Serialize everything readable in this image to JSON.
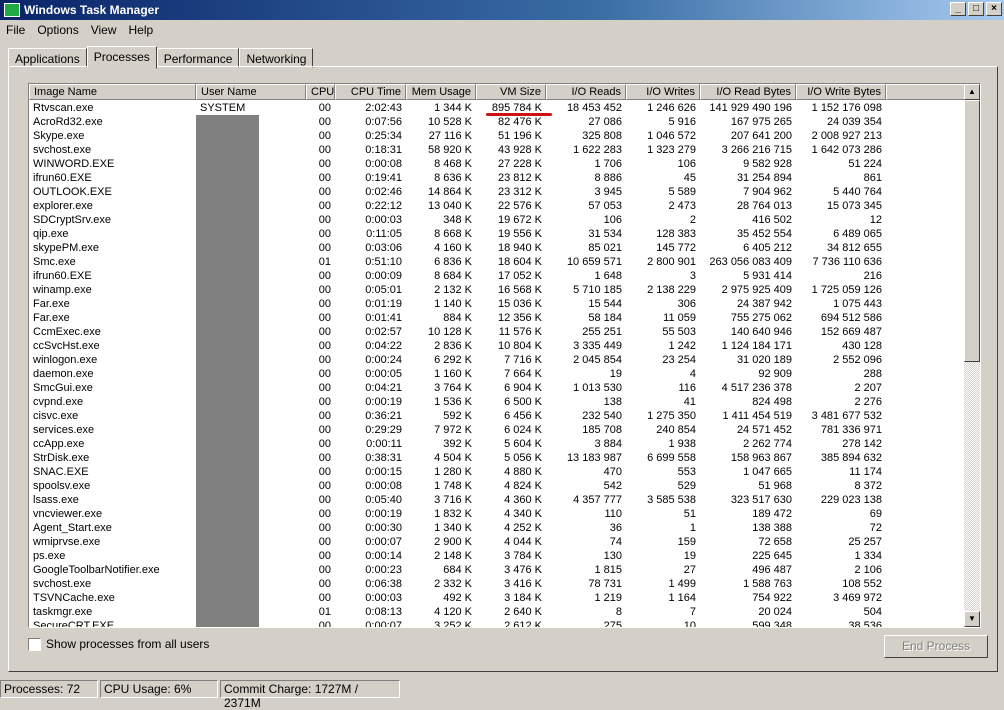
{
  "window": {
    "title": "Windows Task Manager",
    "controls": [
      "_",
      "□",
      "×"
    ]
  },
  "menu": [
    "File",
    "Options",
    "View",
    "Help"
  ],
  "tabs": [
    "Applications",
    "Processes",
    "Performance",
    "Networking"
  ],
  "active_tab": 1,
  "columns": [
    "Image Name",
    "User Name",
    "CPU",
    "CPU Time",
    "Mem Usage",
    "VM Size",
    "I/O Reads",
    "I/O Writes",
    "I/O Read Bytes",
    "I/O Write Bytes"
  ],
  "rows": [
    [
      "Rtvscan.exe",
      "SYSTEM",
      "00",
      "2:02:43",
      "1 344 K",
      "895 784 K",
      "18 453 452",
      "1 246 626",
      "141 929 490 196",
      "1 152 176 098"
    ],
    [
      "AcroRd32.exe",
      "",
      "00",
      "0:07:56",
      "10 528 K",
      "82 476 K",
      "27 086",
      "5 916",
      "167 975 265",
      "24 039 354"
    ],
    [
      "Skype.exe",
      "",
      "00",
      "0:25:34",
      "27 116 K",
      "51 196 K",
      "325 808",
      "1 046 572",
      "207 641 200",
      "2 008 927 213"
    ],
    [
      "svchost.exe",
      "",
      "00",
      "0:18:31",
      "58 920 K",
      "43 928 K",
      "1 622 283",
      "1 323 279",
      "3 266 216 715",
      "1 642 073 286"
    ],
    [
      "WINWORD.EXE",
      "",
      "00",
      "0:00:08",
      "8 468 K",
      "27 228 K",
      "1 706",
      "106",
      "9 582 928",
      "51 224"
    ],
    [
      "ifrun60.EXE",
      "",
      "00",
      "0:19:41",
      "8 636 K",
      "23 812 K",
      "8 886",
      "45",
      "31 254 894",
      "861"
    ],
    [
      "OUTLOOK.EXE",
      "",
      "00",
      "0:02:46",
      "14 864 K",
      "23 312 K",
      "3 945",
      "5 589",
      "7 904 962",
      "5 440 764"
    ],
    [
      "explorer.exe",
      "",
      "00",
      "0:22:12",
      "13 040 K",
      "22 576 K",
      "57 053",
      "2 473",
      "28 764 013",
      "15 073 345"
    ],
    [
      "SDCryptSrv.exe",
      "",
      "00",
      "0:00:03",
      "348 K",
      "19 672 K",
      "106",
      "2",
      "416 502",
      "12"
    ],
    [
      "qip.exe",
      "",
      "00",
      "0:11:05",
      "8 668 K",
      "19 556 K",
      "31 534",
      "128 383",
      "35 452 554",
      "6 489 065"
    ],
    [
      "skypePM.exe",
      "",
      "00",
      "0:03:06",
      "4 160 K",
      "18 940 K",
      "85 021",
      "145 772",
      "6 405 212",
      "34 812 655"
    ],
    [
      "Smc.exe",
      "",
      "01",
      "0:51:10",
      "6 836 K",
      "18 604 K",
      "10 659 571",
      "2 800 901",
      "263 056 083 409",
      "7 736 110 636"
    ],
    [
      "ifrun60.EXE",
      "",
      "00",
      "0:00:09",
      "8 684 K",
      "17 052 K",
      "1 648",
      "3",
      "5 931 414",
      "216"
    ],
    [
      "winamp.exe",
      "",
      "00",
      "0:05:01",
      "2 132 K",
      "16 568 K",
      "5 710 185",
      "2 138 229",
      "2 975 925 409",
      "1 725 059 126"
    ],
    [
      "Far.exe",
      "",
      "00",
      "0:01:19",
      "1 140 K",
      "15 036 K",
      "15 544",
      "306",
      "24 387 942",
      "1 075 443"
    ],
    [
      "Far.exe",
      "",
      "00",
      "0:01:41",
      "884 K",
      "12 356 K",
      "58 184",
      "11 059",
      "755 275 062",
      "694 512 586"
    ],
    [
      "CcmExec.exe",
      "",
      "00",
      "0:02:57",
      "10 128 K",
      "11 576 K",
      "255 251",
      "55 503",
      "140 640 946",
      "152 669 487"
    ],
    [
      "ccSvcHst.exe",
      "",
      "00",
      "0:04:22",
      "2 836 K",
      "10 804 K",
      "3 335 449",
      "1 242",
      "1 124 184 171",
      "430 128"
    ],
    [
      "winlogon.exe",
      "",
      "00",
      "0:00:24",
      "6 292 K",
      "7 716 K",
      "2 045 854",
      "23 254",
      "31 020 189",
      "2 552 096"
    ],
    [
      "daemon.exe",
      "",
      "00",
      "0:00:05",
      "1 160 K",
      "7 664 K",
      "19",
      "4",
      "92 909",
      "288"
    ],
    [
      "SmcGui.exe",
      "",
      "00",
      "0:04:21",
      "3 764 K",
      "6 904 K",
      "1 013 530",
      "116",
      "4 517 236 378",
      "2 207"
    ],
    [
      "cvpnd.exe",
      "",
      "00",
      "0:00:19",
      "1 536 K",
      "6 500 K",
      "138",
      "41",
      "824 498",
      "2 276"
    ],
    [
      "cisvc.exe",
      "",
      "00",
      "0:36:21",
      "592 K",
      "6 456 K",
      "232 540",
      "1 275 350",
      "1 411 454 519",
      "3 481 677 532"
    ],
    [
      "services.exe",
      "",
      "00",
      "0:29:29",
      "7 972 K",
      "6 024 K",
      "185 708",
      "240 854",
      "24 571 452",
      "781 336 971"
    ],
    [
      "ccApp.exe",
      "",
      "00",
      "0:00:11",
      "392 K",
      "5 604 K",
      "3 884",
      "1 938",
      "2 262 774",
      "278 142"
    ],
    [
      "StrDisk.exe",
      "",
      "00",
      "0:38:31",
      "4 504 K",
      "5 056 K",
      "13 183 987",
      "6 699 558",
      "158 963 867",
      "385 894 632"
    ],
    [
      "SNAC.EXE",
      "",
      "00",
      "0:00:15",
      "1 280 K",
      "4 880 K",
      "470",
      "553",
      "1 047 665",
      "11 174"
    ],
    [
      "spoolsv.exe",
      "",
      "00",
      "0:00:08",
      "1 748 K",
      "4 824 K",
      "542",
      "529",
      "51 968",
      "8 372"
    ],
    [
      "lsass.exe",
      "",
      "00",
      "0:05:40",
      "3 716 K",
      "4 360 K",
      "4 357 777",
      "3 585 538",
      "323 517 630",
      "229 023 138"
    ],
    [
      "vncviewer.exe",
      "",
      "00",
      "0:00:19",
      "1 832 K",
      "4 340 K",
      "110",
      "51",
      "189 472",
      "69"
    ],
    [
      "Agent_Start.exe",
      "",
      "00",
      "0:00:30",
      "1 340 K",
      "4 252 K",
      "36",
      "1",
      "138 388",
      "72"
    ],
    [
      "wmiprvse.exe",
      "",
      "00",
      "0:00:07",
      "2 900 K",
      "4 044 K",
      "74",
      "159",
      "72 658",
      "25 257"
    ],
    [
      "ps.exe",
      "",
      "00",
      "0:00:14",
      "2 148 K",
      "3 784 K",
      "130",
      "19",
      "225 645",
      "1 334"
    ],
    [
      "GoogleToolbarNotifier.exe",
      "",
      "00",
      "0:00:23",
      "684 K",
      "3 476 K",
      "1 815",
      "27",
      "496 487",
      "2 106"
    ],
    [
      "svchost.exe",
      "",
      "00",
      "0:06:38",
      "2 332 K",
      "3 416 K",
      "78 731",
      "1 499",
      "1 588 763",
      "108 552"
    ],
    [
      "TSVNCache.exe",
      "",
      "00",
      "0:00:03",
      "492 K",
      "3 184 K",
      "1 219",
      "1 164",
      "754 922",
      "3 469 972"
    ],
    [
      "taskmgr.exe",
      "",
      "01",
      "0:08:13",
      "4 120 K",
      "2 640 K",
      "8",
      "7",
      "20 024",
      "504"
    ],
    [
      "SecureCRT.EXE",
      "",
      "00",
      "0:00:07",
      "3 252 K",
      "2 612 K",
      "275",
      "10",
      "599 348",
      "38 536"
    ]
  ],
  "show_all_users_label": "Show processes from all users",
  "end_process_label": "End Process",
  "status": {
    "processes": "Processes: 72",
    "cpu": "CPU Usage: 6%",
    "commit": "Commit Charge: 1727M / 2371M"
  },
  "colors": {
    "highlight_underline": "#d01010",
    "title_bar": "#0a246a"
  }
}
